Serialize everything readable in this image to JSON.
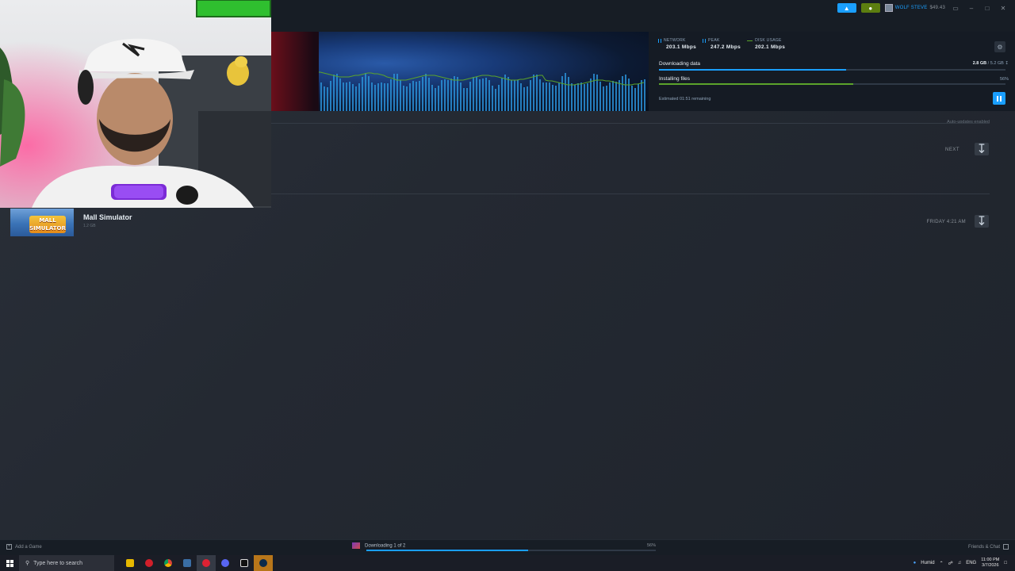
{
  "topbar": {
    "user_name": "WOLF STEVE",
    "wallet": "$49.43"
  },
  "stats": {
    "network_label": "NETWORK",
    "network_value": "203.1 Mbps",
    "peak_label": "PEAK",
    "peak_value": "247.2 Mbps",
    "disk_label": "DISK USAGE",
    "disk_value": "202.1 Mbps"
  },
  "progress": {
    "downloading_label": "Downloading data",
    "downloaded": "2.8 GB",
    "total": "/ 5.2 GB",
    "download_fraction": 0.54,
    "installing_label": "Installing files",
    "install_pct": "56%",
    "install_fraction": 0.56,
    "eta": "Estimated 01:51 remaining"
  },
  "auto_updates": "Auto-updates enabled",
  "next_label": "NEXT",
  "game": {
    "logo_line1": "MALL",
    "logo_line2": "SIMULATOR",
    "title": "Mall Simulator",
    "size": "1.2 GB",
    "scheduled": "FRIDAY 4:21 AM"
  },
  "bottom": {
    "add_game": "Add a Game",
    "status": "Downloading 1 of 2",
    "pct": "56%",
    "fraction": 0.56,
    "friends": "Friends & Chat"
  },
  "taskbar": {
    "search_placeholder": "Type here to search",
    "weather": "Humid",
    "lang": "ENG",
    "time": "11:00 PM",
    "date": "3/7/2026"
  },
  "colors": {
    "accent": "#1a9fff",
    "green": "#5ba32b",
    "network": "#1a9fff",
    "disk": "#5ba32b"
  }
}
